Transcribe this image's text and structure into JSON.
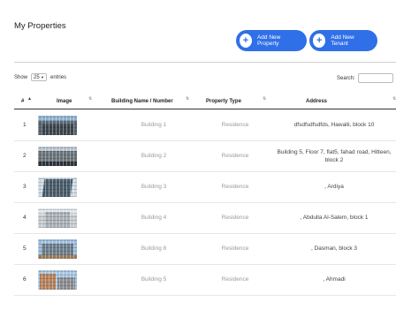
{
  "page": {
    "title": "My Properties"
  },
  "actions": {
    "add_property": "Add New Property",
    "add_tenant": "Add New Tenant",
    "plus_glyph": "+"
  },
  "table_controls": {
    "show_label": "Show",
    "page_size": "25",
    "entries_label": "entries",
    "search_label": "Search:"
  },
  "table": {
    "columns": [
      {
        "label": "#",
        "sort_indicator": "▲"
      },
      {
        "label": "Image",
        "sort_indicator": "⇅"
      },
      {
        "label": "Building Name / Number",
        "sort_indicator": "⇅"
      },
      {
        "label": "Property Type",
        "sort_indicator": "⇅"
      },
      {
        "label": "Address",
        "sort_indicator": "⇅"
      }
    ],
    "rows": [
      {
        "no": "1",
        "building": "Building 1",
        "type": "Residence",
        "address": "dfsdfsdfsdfds, Hawalli, block 10"
      },
      {
        "no": "2",
        "building": "Building 2",
        "type": "Residence",
        "address": "Building 5, Floor 7, flat5, fahad road, Hitteen, block 2"
      },
      {
        "no": "3",
        "building": "Building 3",
        "type": "Residence",
        "address": ", Ardiya"
      },
      {
        "no": "4",
        "building": "Building 4",
        "type": "Residence",
        "address": ", Abdulla Al-Salem, block 1"
      },
      {
        "no": "5",
        "building": "Building 8",
        "type": "Residence",
        "address": ", Dasman, block 3"
      },
      {
        "no": "6",
        "building": "Building 5",
        "type": "Residence",
        "address": ", Ahmadi"
      }
    ]
  },
  "colors": {
    "accent": "#2f6fe8",
    "muted_text": "#9a9a9a"
  }
}
